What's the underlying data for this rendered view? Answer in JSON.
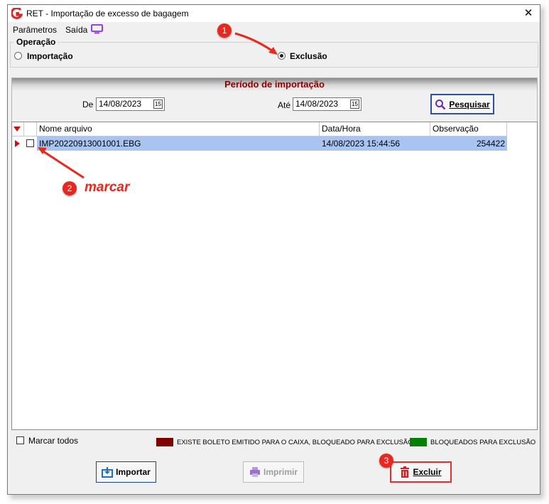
{
  "window": {
    "title": "RET - Importação de excesso de bagagem",
    "close_glyph": "✕"
  },
  "menu": {
    "items": [
      "Parâmetros",
      "Saída"
    ],
    "icon": "monitor-icon"
  },
  "operation": {
    "group_label": "Operação",
    "options": [
      {
        "label": "Importação",
        "selected": false
      },
      {
        "label": "Exclusão",
        "selected": true
      }
    ]
  },
  "period": {
    "title": "Período de importação",
    "from_label": "De",
    "from_value": "14/08/2023",
    "to_label": "Até",
    "to_value": "14/08/2023",
    "calendar_glyph": "15",
    "search_button": "Pesquisar"
  },
  "grid": {
    "columns": [
      "Nome arquivo",
      "Data/Hora",
      "Observação"
    ],
    "rows": [
      {
        "file": "IMP20220913001001.EBG",
        "datetime": "14/08/2023 15:44:56",
        "observation": "254422",
        "checked": false
      }
    ]
  },
  "footer": {
    "select_all": "Marcar todos",
    "legend": [
      {
        "color": "#800000",
        "text": "EXISTE BOLETO EMITIDO PARA O CAIXA, BLOQUEADO PARA EXCLUSÃO"
      },
      {
        "color": "#008000",
        "text": "BLOQUEADOS PARA EXCLUSÃO"
      }
    ],
    "buttons": {
      "import": "Importar",
      "print": "Imprimir",
      "delete": "Excluir"
    }
  },
  "annotations": {
    "step1": "1",
    "step2": "2",
    "step2_text": "marcar",
    "step3": "3",
    "accent": "#e8281e"
  }
}
